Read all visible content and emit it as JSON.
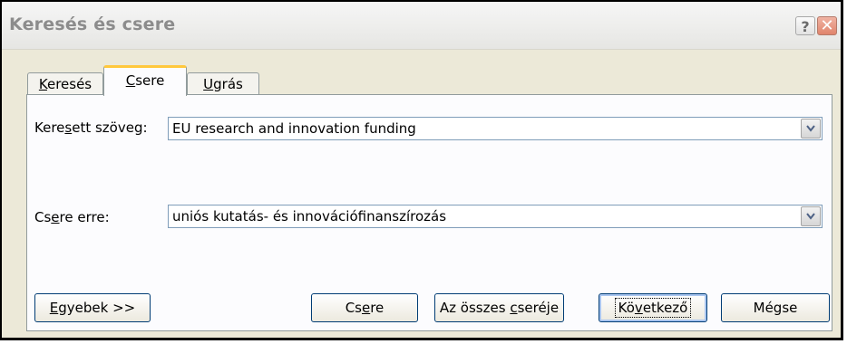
{
  "window": {
    "title": "Keresés és csere",
    "help_label": "?",
    "close_label": "✕"
  },
  "tabs": [
    {
      "pre": "",
      "key": "K",
      "post": "eresés",
      "active": false
    },
    {
      "pre": "",
      "key": "C",
      "post": "sere",
      "active": true
    },
    {
      "pre": "",
      "key": "U",
      "post": "grás",
      "active": false
    }
  ],
  "find": {
    "label_pre": "Kere",
    "label_key": "s",
    "label_post": "ett szöveg:",
    "value": "EU research and innovation funding"
  },
  "replace": {
    "label_pre": "Cs",
    "label_key": "e",
    "label_post": "re erre:",
    "value": "uniós kutatás- és innovációfinanszírozás"
  },
  "buttons": {
    "more": {
      "pre": "",
      "key": "E",
      "post": "gyebek >>"
    },
    "replace": {
      "pre": "Cs",
      "key": "e",
      "post": "re"
    },
    "replace_all": {
      "pre": "Az összes ",
      "key": "c",
      "post": "seréje"
    },
    "next": {
      "pre": "Kö",
      "key": "v",
      "post": "etkező"
    },
    "cancel": {
      "label": "Mégse"
    }
  }
}
